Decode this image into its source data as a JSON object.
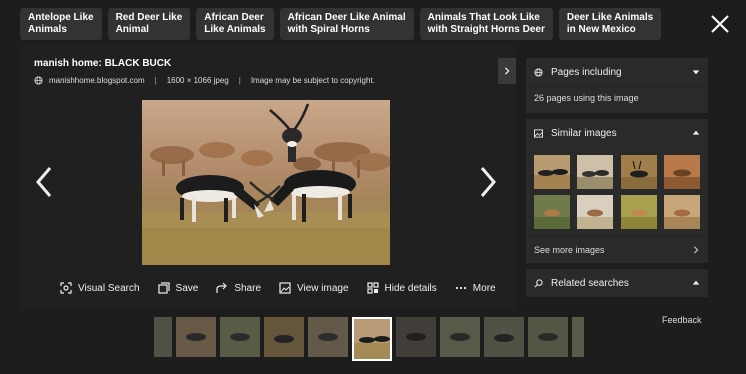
{
  "chips": [
    "Antelope Like Animals",
    "Red Deer Like Animal",
    "African Deer Like Animals",
    "African Deer Like Animal with Spiral Horns",
    "Animals That Look Like with Straight Horns Deer",
    "Deer Like Animals in New Mexico"
  ],
  "chip_lines": [
    [
      "Antelope Like",
      "Animals"
    ],
    [
      "Red Deer Like",
      "Animal"
    ],
    [
      "African Deer",
      "Like Animals"
    ],
    [
      "African Deer Like Animal",
      "with Spiral Horns"
    ],
    [
      "Animals That Look Like",
      "with Straight Horns Deer"
    ],
    [
      "Deer Like Animals",
      "in New Mexico"
    ]
  ],
  "viewer": {
    "title": "manish home: BLACK BUCK",
    "source": "manishhome.blogspot.com",
    "dimensions": "1600 × 1066 jpeg",
    "copyright": "Image may be subject to copyright."
  },
  "actions": {
    "visual_search": "Visual Search",
    "save": "Save",
    "share": "Share",
    "view_image": "View image",
    "hide_details": "Hide details",
    "more": "More"
  },
  "side": {
    "pages_including": "Pages including",
    "pages_count": "26 pages using this image",
    "similar_images": "Similar images",
    "see_more": "See more images",
    "related_searches": "Related searches"
  },
  "feedback": "Feedback",
  "icons": {
    "close": "close-icon",
    "prev": "chevron-left-icon",
    "next": "chevron-right-icon",
    "expand": "chevron-right-icon"
  },
  "colors": {
    "background": "#1d1d1d",
    "panel": "#202020",
    "card": "#2a2a2a",
    "chip": "#333333"
  }
}
